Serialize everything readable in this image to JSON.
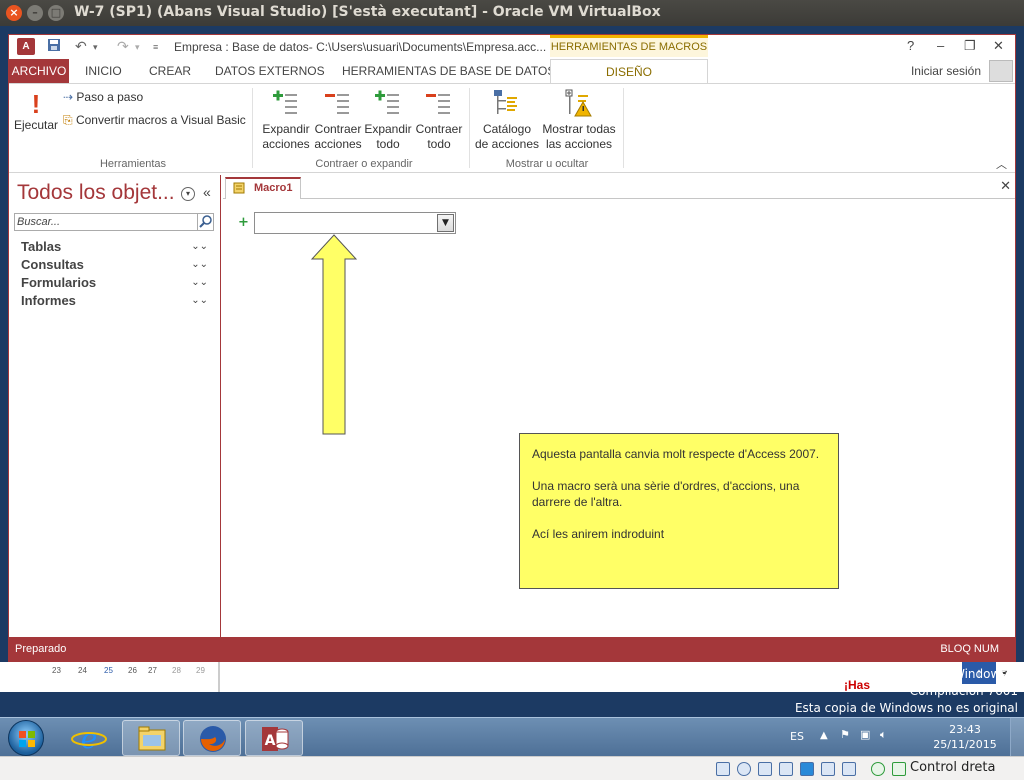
{
  "host": {
    "title": "W-7 (SP1) (Abans Visual Studio) [S'està executant] - Oracle VM VirtualBox",
    "close_glyph": "×",
    "minimize_glyph": "–",
    "maximize_glyph": "□"
  },
  "access": {
    "doc_title": "Empresa : Base de datos- C:\\Users\\usuari\\Documents\\Empresa.acc...",
    "context_tab": "HERRAMIENTAS DE MACROS",
    "help_glyph": "?",
    "tabs": [
      "ARCHIVO",
      "INICIO",
      "CREAR",
      "DATOS EXTERNOS",
      "HERRAMIENTAS DE BASE DE DATOS",
      "DISEÑO"
    ],
    "signin": "Iniciar sesión",
    "ribbon": {
      "run": "Ejecutar",
      "step": "Paso a paso",
      "convert": "Convertir macros a Visual Basic",
      "group_tools": "Herramientas",
      "expand_actions": [
        "Expandir",
        "acciones"
      ],
      "collapse_actions": [
        "Contraer",
        "acciones"
      ],
      "expand_all": [
        "Expandir",
        "todo"
      ],
      "collapse_all": [
        "Contraer",
        "todo"
      ],
      "group_expand": "Contraer o expandir",
      "action_catalog": [
        "Catálogo",
        "de acciones"
      ],
      "show_all": [
        "Mostrar todas",
        "las acciones"
      ],
      "group_show": "Mostrar u ocultar"
    },
    "nav": {
      "title": "Todos los objet...",
      "search_placeholder": "Buscar...",
      "categories": [
        "Tablas",
        "Consultas",
        "Formularios",
        "Informes"
      ]
    },
    "doc_tab": "Macro1",
    "callout": [
      "Aquesta pantalla canvia molt respecte d'Access 2007.",
      "Una macro serà una sèrie d'ordres, d'accions, una darrere de l'altra.",
      "Ací les anirem indroduint"
    ],
    "status_left": "Preparado",
    "status_right": "BLOQ NUM"
  },
  "behind": {
    "calendar_days": [
      "23",
      "24",
      "25",
      "26",
      "27",
      "28",
      "29"
    ],
    "promo_text": "¡Has"
  },
  "windows_info": [
    "Windows 7",
    "Compilación 7601",
    "Esta copia de Windows no es original"
  ],
  "tray": {
    "language": "ES",
    "time": "23:43",
    "date": "25/11/2015"
  },
  "vbox": {
    "host_key": "Control dreta"
  },
  "colors": {
    "access_accent": "#a4373a",
    "callout_bg": "#ffff66",
    "context_tab": "#f0b400"
  }
}
